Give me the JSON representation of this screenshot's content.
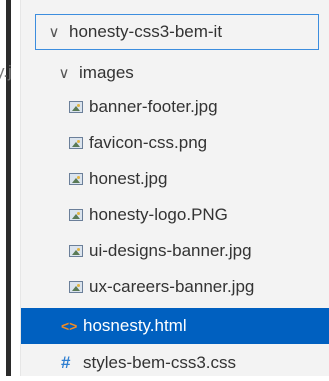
{
  "clipped_text": "y.j",
  "explorer": {
    "root_folder": {
      "label": "honesty-css3-bem-it",
      "expanded": true
    },
    "images_folder": {
      "label": "images",
      "expanded": true
    },
    "image_files": [
      {
        "label": "banner-footer.jpg"
      },
      {
        "label": "favicon-css.png"
      },
      {
        "label": "honest.jpg"
      },
      {
        "label": "honesty-logo.PNG"
      },
      {
        "label": "ui-designs-banner.jpg"
      },
      {
        "label": "ux-careers-banner.jpg"
      }
    ],
    "html_file": {
      "label": "hosnesty.html",
      "selected": true
    },
    "css_file": {
      "label": "styles-bem-css3.css"
    }
  },
  "colors": {
    "selection": "#0060c0",
    "html_icon": "#f08a24",
    "css_icon": "#2f7fd1",
    "focus_border": "#3c8dde"
  }
}
